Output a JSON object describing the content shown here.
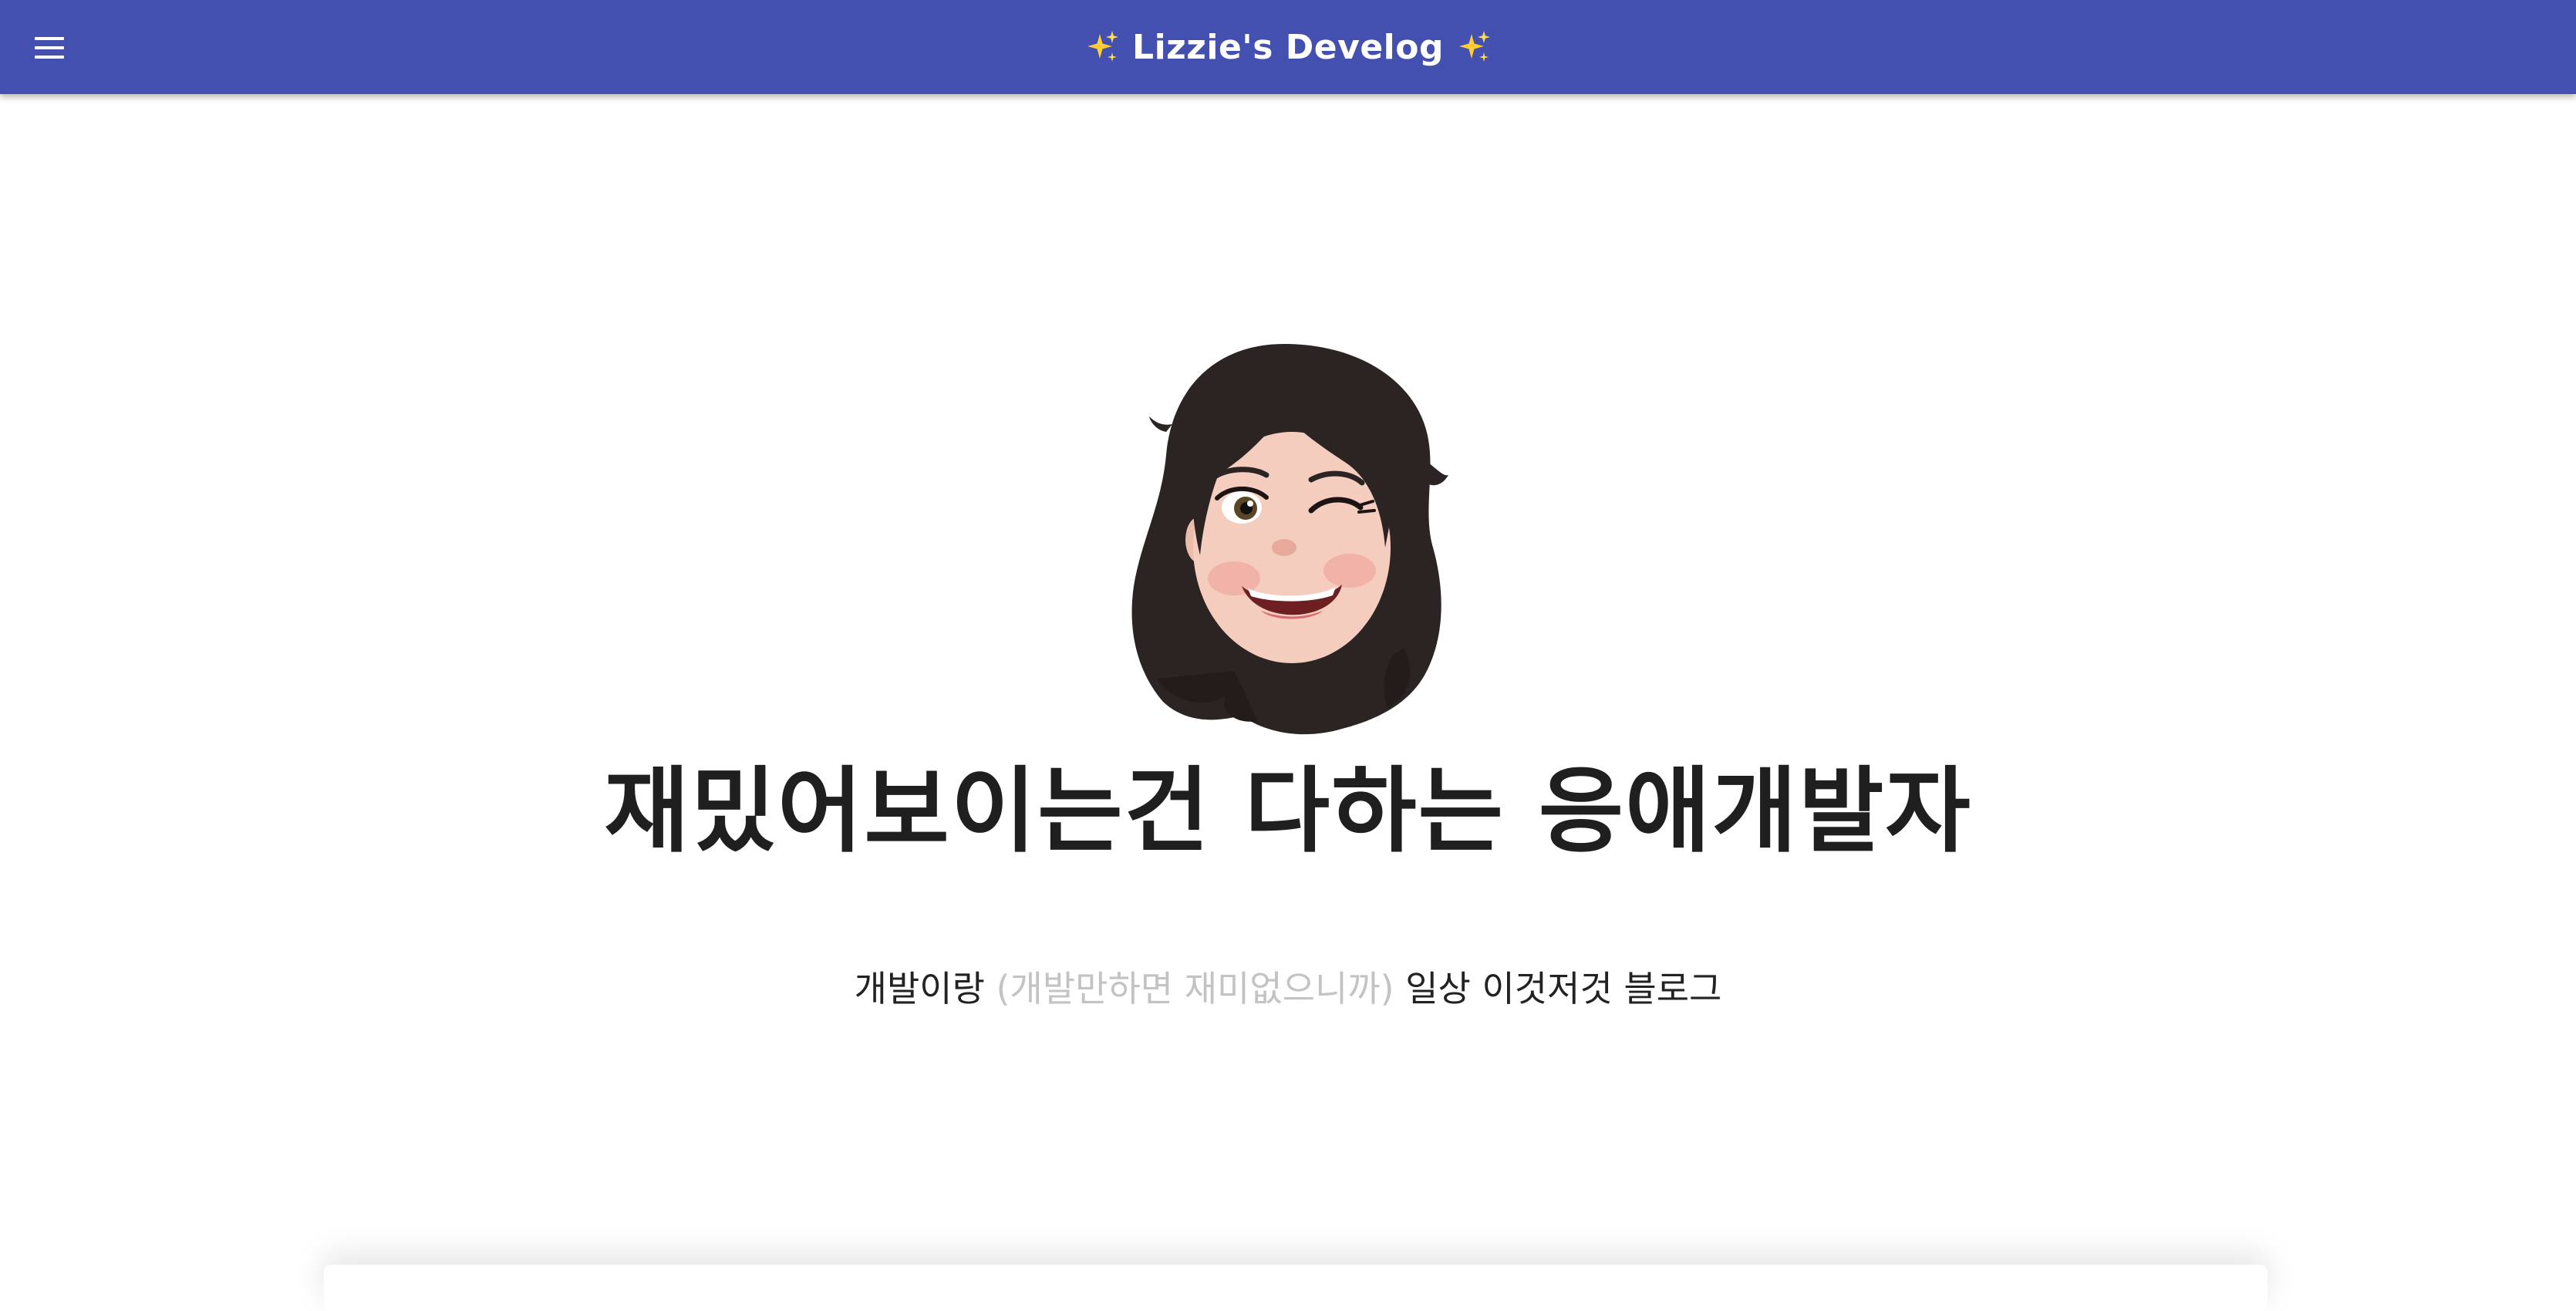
{
  "header": {
    "title": "Lizzie's Develog",
    "menu_icon": "hamburger-menu-icon",
    "sparkle_icon": "sparkles-emoji",
    "background_color": "#4450b0"
  },
  "hero": {
    "avatar_icon": "memoji-avatar-winking-girl",
    "headline": "재밌어보이는건 다하는 응애개발자",
    "subtitle_start": "개발이랑",
    "subtitle_muted": "(개발만하면 재미없으니까)",
    "subtitle_end": "일상 이것저것 블로그"
  }
}
